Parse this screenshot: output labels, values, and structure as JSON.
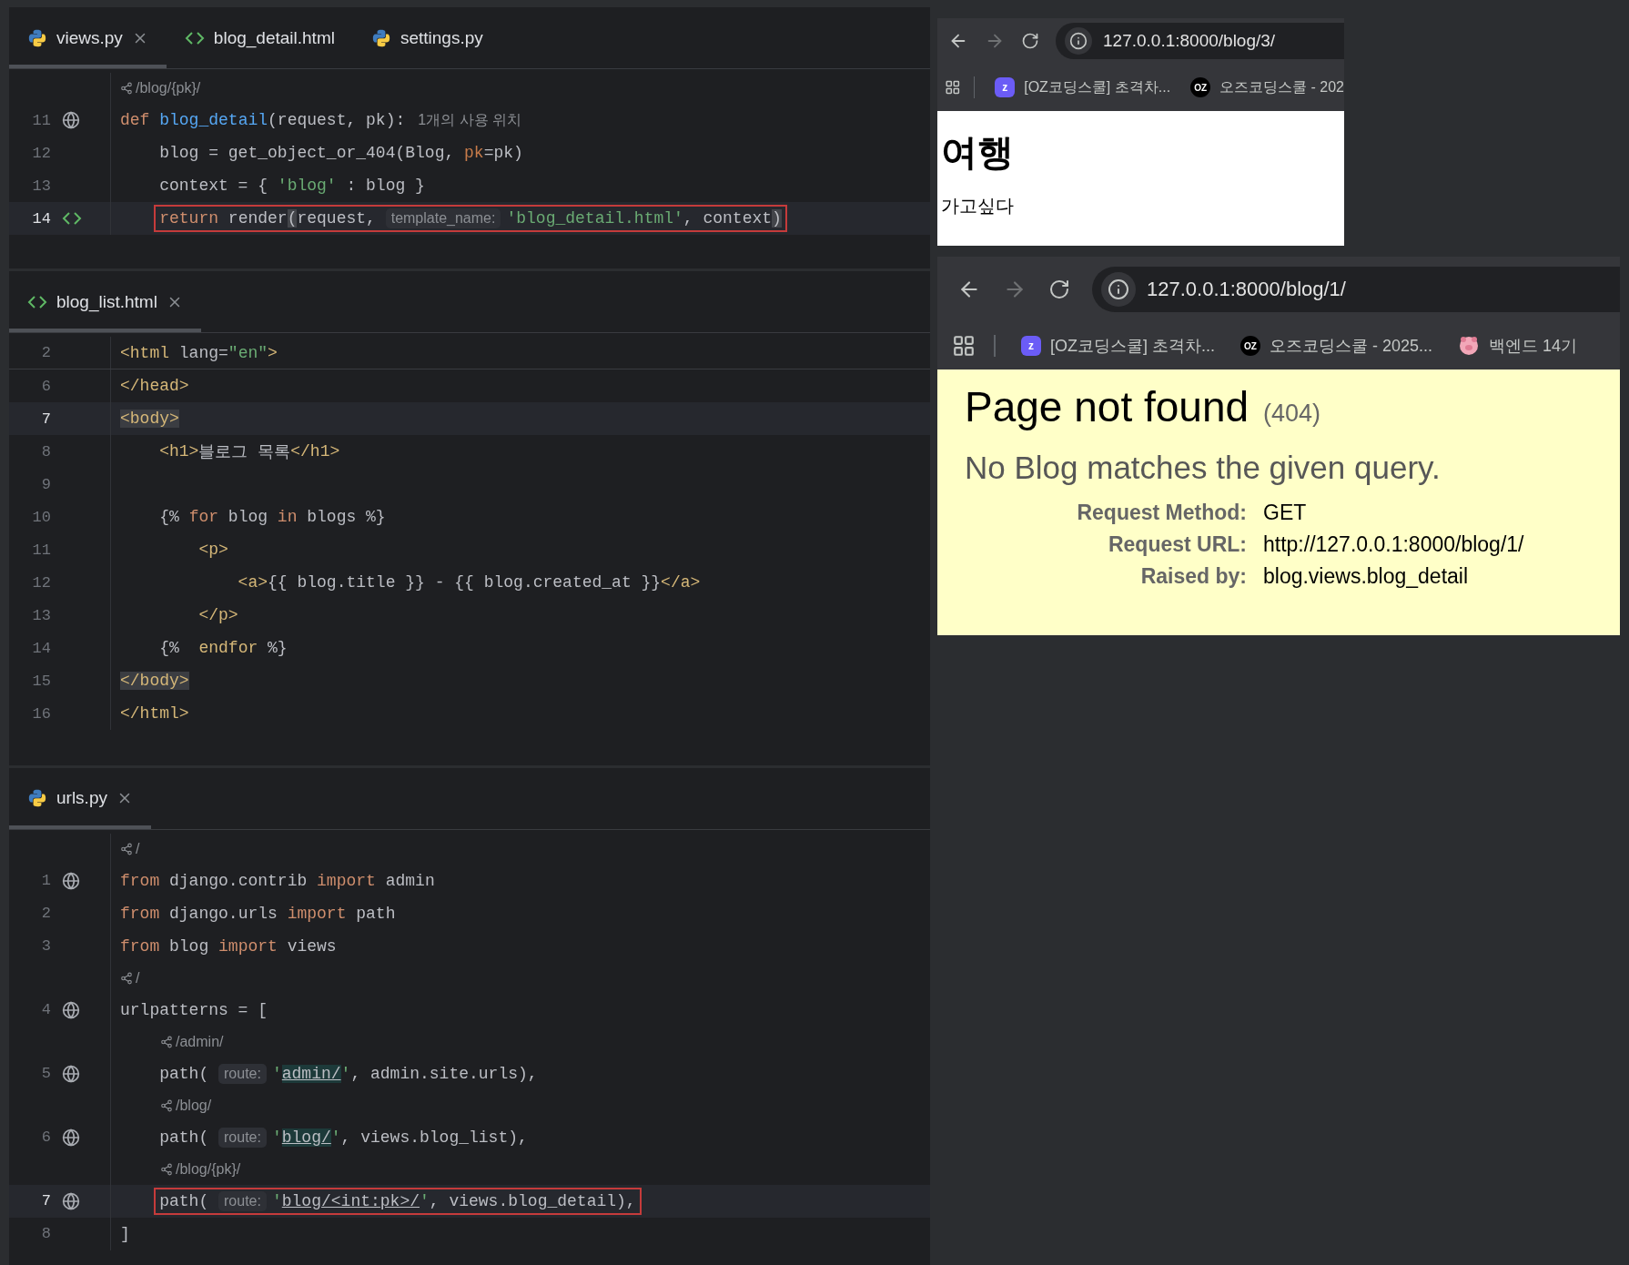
{
  "editor_panes": [
    {
      "tabs": [
        {
          "label": "views.py",
          "kind": "python",
          "selected": true,
          "closable": true
        },
        {
          "label": "blog_detail.html",
          "kind": "html",
          "selected": false,
          "closable": false
        },
        {
          "label": "settings.py",
          "kind": "python",
          "selected": false,
          "closable": false
        }
      ],
      "lines": [
        {
          "kind": "route",
          "text": "/blog/{pk}/"
        },
        {
          "kind": "code",
          "number": "11",
          "gutter_icon": {
            "kind": "globe"
          },
          "current": false,
          "boxed": false,
          "tokens": [
            {
              "kind": "kw",
              "text": "def "
            },
            {
              "kind": "fn",
              "text": "blog_detail"
            },
            {
              "kind": "plain",
              "text": "(request, pk):"
            },
            {
              "kind": "usage",
              "text": "1개의 사용 위치"
            }
          ]
        },
        {
          "kind": "code",
          "number": "12",
          "current": false,
          "boxed": false,
          "tokens": [
            {
              "kind": "plain",
              "text": "    blog = get_object_or_404(Blog, "
            },
            {
              "kind": "param",
              "text": "pk"
            },
            {
              "kind": "plain",
              "text": "=pk)"
            }
          ]
        },
        {
          "kind": "code",
          "number": "13",
          "current": false,
          "boxed": false,
          "tokens": [
            {
              "kind": "plain",
              "text": "    context = { "
            },
            {
              "kind": "str",
              "text": "'blog'"
            },
            {
              "kind": "plain",
              "text": " : blog }"
            }
          ]
        },
        {
          "kind": "code",
          "number": "14",
          "gutter_icon": {
            "kind": "tag"
          },
          "current": true,
          "boxed": true,
          "tokens": [
            {
              "kind": "kw",
              "text": "    return "
            },
            {
              "kind": "plain",
              "text": "render"
            },
            {
              "kind": "match",
              "text": "("
            },
            {
              "kind": "plain",
              "text": "request, "
            },
            {
              "kind": "hint",
              "text": "template_name:"
            },
            {
              "kind": "str",
              "text": "'blog_detail.html'"
            },
            {
              "kind": "plain",
              "text": ", context"
            },
            {
              "kind": "match",
              "text": ")"
            }
          ]
        }
      ]
    },
    {
      "tabs": [
        {
          "label": "blog_list.html",
          "kind": "html",
          "selected": true,
          "closable": true
        }
      ],
      "lines": [
        {
          "kind": "sticky",
          "number": "2",
          "tokens": [
            {
              "kind": "tag",
              "text": "<html "
            },
            {
              "kind": "plain",
              "text": "lang="
            },
            {
              "kind": "str",
              "text": "\"en\""
            },
            {
              "kind": "tag",
              "text": ">"
            }
          ]
        },
        {
          "kind": "code",
          "number": "6",
          "current": false,
          "boxed": false,
          "tokens": [
            {
              "kind": "tag",
              "text": "</head>"
            }
          ]
        },
        {
          "kind": "code",
          "number": "7",
          "current": true,
          "boxed": false,
          "tokens": [
            {
              "kind": "tagmatch",
              "text": "<body>"
            }
          ]
        },
        {
          "kind": "code",
          "number": "8",
          "current": false,
          "boxed": false,
          "tokens": [
            {
              "kind": "tag",
              "text": "    <h1>"
            },
            {
              "kind": "plain",
              "text": "블로그 목록"
            },
            {
              "kind": "tag",
              "text": "</h1>"
            }
          ]
        },
        {
          "kind": "code",
          "number": "9",
          "current": false,
          "boxed": false
        },
        {
          "kind": "code",
          "number": "10",
          "current": false,
          "boxed": false,
          "tokens": [
            {
              "kind": "plain",
              "text": "    {% "
            },
            {
              "kind": "kw",
              "text": "for"
            },
            {
              "kind": "plain",
              "text": " blog "
            },
            {
              "kind": "kw",
              "text": "in"
            },
            {
              "kind": "plain",
              "text": " blogs %}"
            }
          ]
        },
        {
          "kind": "code",
          "number": "11",
          "current": false,
          "boxed": false,
          "tokens": [
            {
              "kind": "tag",
              "text": "        <p>"
            }
          ]
        },
        {
          "kind": "code",
          "number": "12",
          "current": false,
          "boxed": false,
          "tokens": [
            {
              "kind": "tag",
              "text": "            <a>"
            },
            {
              "kind": "plain",
              "text": "{{ blog.title }} - {{ blog.created_at }}"
            },
            {
              "kind": "tag",
              "text": "</a>"
            }
          ]
        },
        {
          "kind": "code",
          "number": "13",
          "current": false,
          "boxed": false,
          "tokens": [
            {
              "kind": "tag",
              "text": "        </p>"
            }
          ]
        },
        {
          "kind": "code",
          "number": "14",
          "current": false,
          "boxed": false,
          "tokens": [
            {
              "kind": "plain",
              "text": "    {%  "
            },
            {
              "kind": "tag",
              "text": "endfor"
            },
            {
              "kind": "plain",
              "text": " %}"
            }
          ]
        },
        {
          "kind": "code",
          "number": "15",
          "current": false,
          "boxed": false,
          "tokens": [
            {
              "kind": "tagmatch",
              "text": "</body>"
            }
          ]
        },
        {
          "kind": "code",
          "number": "16",
          "current": false,
          "boxed": false,
          "tokens": [
            {
              "kind": "tag",
              "text": "</html>"
            }
          ]
        }
      ]
    },
    {
      "tabs": [
        {
          "label": "urls.py",
          "kind": "python",
          "selected": true,
          "closable": true
        }
      ],
      "lines": [
        {
          "kind": "route",
          "text": "/"
        },
        {
          "kind": "code",
          "number": "1",
          "gutter_icon": {
            "kind": "globe"
          },
          "current": false,
          "boxed": false,
          "tokens": [
            {
              "kind": "kw",
              "text": "from "
            },
            {
              "kind": "plain",
              "text": "django.contrib "
            },
            {
              "kind": "kw",
              "text": "import "
            },
            {
              "kind": "plain",
              "text": "admin"
            }
          ]
        },
        {
          "kind": "code",
          "number": "2",
          "current": false,
          "boxed": false,
          "tokens": [
            {
              "kind": "kw",
              "text": "from "
            },
            {
              "kind": "plain",
              "text": "django.urls "
            },
            {
              "kind": "kw",
              "text": "import "
            },
            {
              "kind": "plain",
              "text": "path"
            }
          ]
        },
        {
          "kind": "code",
          "number": "3",
          "current": false,
          "boxed": false,
          "tokens": [
            {
              "kind": "kw",
              "text": "from "
            },
            {
              "kind": "plain",
              "text": "blog "
            },
            {
              "kind": "kw",
              "text": "import "
            },
            {
              "kind": "plain",
              "text": "views"
            }
          ]
        },
        {
          "kind": "route",
          "text": "/"
        },
        {
          "kind": "code",
          "number": "4",
          "gutter_icon": {
            "kind": "globe"
          },
          "current": false,
          "boxed": false,
          "tokens": [
            {
              "kind": "plain",
              "text": "urlpatterns = ["
            }
          ]
        },
        {
          "kind": "route",
          "text": "/admin/"
        },
        {
          "kind": "code",
          "number": "5",
          "gutter_icon": {
            "kind": "globe"
          },
          "current": false,
          "boxed": false,
          "tokens": [
            {
              "kind": "plain",
              "text": "    path( "
            },
            {
              "kind": "hint",
              "text": "route:"
            },
            {
              "kind": "str",
              "text": "'"
            },
            {
              "kind": "url",
              "text": "admin/"
            },
            {
              "kind": "str",
              "text": "'"
            },
            {
              "kind": "plain",
              "text": ", admin.site.urls),"
            }
          ]
        },
        {
          "kind": "route",
          "text": "/blog/"
        },
        {
          "kind": "code",
          "number": "6",
          "gutter_icon": {
            "kind": "globe"
          },
          "current": false,
          "boxed": false,
          "tokens": [
            {
              "kind": "plain",
              "text": "    path( "
            },
            {
              "kind": "hint",
              "text": "route:"
            },
            {
              "kind": "str",
              "text": "'"
            },
            {
              "kind": "url",
              "text": "blog/"
            },
            {
              "kind": "str",
              "text": "'"
            },
            {
              "kind": "plain",
              "text": ", views.blog_list),"
            }
          ]
        },
        {
          "kind": "route",
          "text": "/blog/{pk}/"
        },
        {
          "kind": "code",
          "number": "7",
          "gutter_icon": {
            "kind": "globe"
          },
          "current": true,
          "boxed": true,
          "tokens": [
            {
              "kind": "plain",
              "text": "    path( "
            },
            {
              "kind": "hint",
              "text": "route:"
            },
            {
              "kind": "str",
              "text": "'"
            },
            {
              "kind": "urlplain",
              "text": "blog/<int:pk>/"
            },
            {
              "kind": "str",
              "text": "'"
            },
            {
              "kind": "plain",
              "text": ", views.blog_detail),"
            }
          ]
        },
        {
          "kind": "code",
          "number": "8",
          "current": false,
          "boxed": false,
          "tokens": [
            {
              "kind": "plain",
              "text": "]"
            }
          ]
        }
      ]
    }
  ],
  "browsers": [
    {
      "forward_enabled": false,
      "url": "127.0.0.1:8000/blog/3/",
      "bookmarks": [
        {
          "kind": "z",
          "badge": "z",
          "label": "[OZ코딩스쿨] 초격차..."
        },
        {
          "kind": "oz",
          "badge": "OZ",
          "label": "오즈코딩스쿨 - 202"
        }
      ],
      "content": {
        "kind": "simple",
        "heading": "여행",
        "text": "가고싶다"
      }
    },
    {
      "forward_enabled": false,
      "url": "127.0.0.1:8000/blog/1/",
      "bookmarks": [
        {
          "kind": "z",
          "badge": "z",
          "label": "[OZ코딩스쿨] 초격차..."
        },
        {
          "kind": "oz",
          "badge": "OZ",
          "label": "오즈코딩스쿨 - 2025..."
        },
        {
          "kind": "pig",
          "label": "백엔드 14기"
        }
      ],
      "content": {
        "kind": "django_404",
        "title": "Page not found",
        "code": "(404)",
        "message": "No Blog matches the given query.",
        "details": [
          {
            "label": "Request Method:",
            "value": "GET"
          },
          {
            "label": "Request URL:",
            "value": "http://127.0.0.1:8000/blog/1/"
          },
          {
            "label": "Raised by:",
            "value": "blog.views.blog_detail"
          }
        ]
      }
    }
  ]
}
